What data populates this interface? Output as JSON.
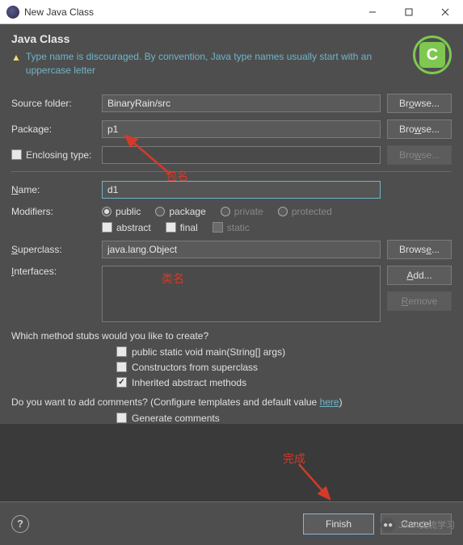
{
  "titlebar": {
    "title": "New Java Class"
  },
  "header": {
    "heading": "Java Class",
    "warning": "Type name is discouraged. By convention, Java type names usually start with an uppercase letter",
    "badge": "C"
  },
  "labels": {
    "source_folder": "Source folder:",
    "package": "Package:",
    "enclosing_type": "Enclosing type:",
    "name": "Name:",
    "modifiers": "Modifiers:",
    "superclass": "Superclass:",
    "interfaces": "Interfaces:"
  },
  "fields": {
    "source_folder": "BinaryRain/src",
    "package": "p1",
    "enclosing_type": "",
    "name": "d1",
    "superclass": "java.lang.Object"
  },
  "buttons": {
    "browse": "Browse...",
    "add": "Add...",
    "remove": "Remove",
    "finish": "Finish",
    "cancel": "Cancel"
  },
  "modifiers": {
    "public": "public",
    "package": "package",
    "private": "private",
    "protected": "protected",
    "abstract": "abstract",
    "final": "final",
    "static": "static"
  },
  "questions": {
    "stubs": "Which method stubs would you like to create?",
    "main": "public static void main(String[] args)",
    "constructors": "Constructors from superclass",
    "inherited": "Inherited abstract methods",
    "comments_q": "Do you want to add comments? (Configure templates and default value ",
    "here": "here",
    "comments_end": ")",
    "generate": "Generate comments"
  },
  "annotations": {
    "package_name": "包名",
    "class_name": "类名",
    "finish": "完成"
  },
  "watermark": "JAVA交流学习"
}
